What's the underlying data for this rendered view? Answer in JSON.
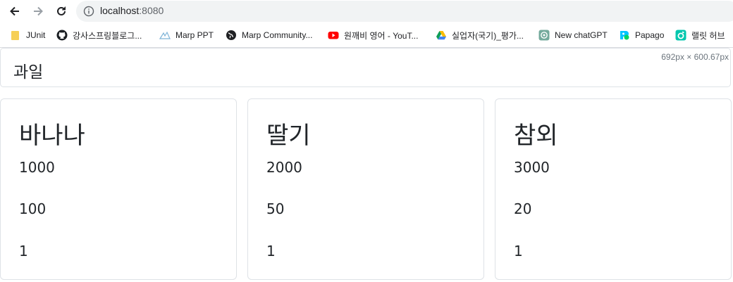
{
  "browser": {
    "url_host": "localhost",
    "url_port": ":8080",
    "bookmarks": [
      {
        "label": "JUnit",
        "icon": "folder-icon"
      },
      {
        "label": "강사스프링블로그...",
        "icon": "github-icon"
      },
      {
        "label": "Marp PPT",
        "icon": "marp-icon"
      },
      {
        "label": "Marp Community...",
        "icon": "globe-icon"
      },
      {
        "label": "원깨비 영어 - YouT...",
        "icon": "youtube-icon"
      },
      {
        "label": "실업자(국기)_평가...",
        "icon": "google-drive-icon"
      },
      {
        "label": "New chatGPT",
        "icon": "chatgpt-icon"
      },
      {
        "label": "Papago",
        "icon": "papago-icon"
      },
      {
        "label": "랠릿 허브",
        "icon": "rallit-icon"
      }
    ]
  },
  "page": {
    "size_label": "692px × 600.67px",
    "header_title": "과일",
    "cards": [
      {
        "name": "바나나",
        "values": [
          "1000",
          "100",
          "1"
        ]
      },
      {
        "name": "딸기",
        "values": [
          "2000",
          "50",
          "1"
        ]
      },
      {
        "name": "참외",
        "values": [
          "3000",
          "20",
          "1"
        ]
      }
    ]
  },
  "colors": {
    "youtube": "#ff0000",
    "folder": "#f6cf57",
    "border": "#dee2e6"
  }
}
